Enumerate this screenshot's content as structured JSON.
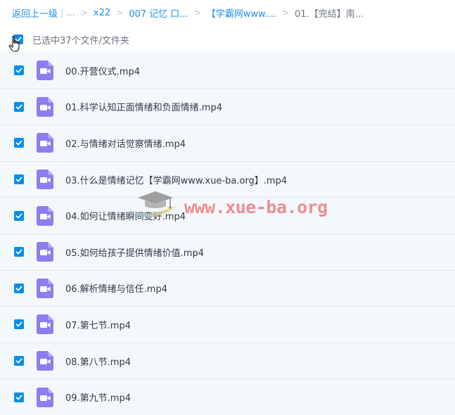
{
  "breadcrumb": {
    "back_label": "返回上一级",
    "pipe": "|",
    "ellipsis": "...",
    "sep": ">",
    "crumbs": [
      "x22",
      "007 记忆 口...",
      "【学霸网www....",
      "01.【完结】南..."
    ]
  },
  "selection": {
    "text": "已选中37个文件/文件夹",
    "all_checked": true
  },
  "files": [
    {
      "name": "00.开营仪式.mp4",
      "checked": true
    },
    {
      "name": "01.科学认知正面情绪和负面情绪.mp4",
      "checked": true
    },
    {
      "name": "02.与情绪对话觉察情绪.mp4",
      "checked": true
    },
    {
      "name": "03.什么是情绪记忆【学霸网www.xue-ba.org】.mp4",
      "checked": true
    },
    {
      "name": "04.如何让情绪瞬间变好.mp4",
      "checked": true
    },
    {
      "name": "05.如何给孩子提供情绪价值.mp4",
      "checked": true
    },
    {
      "name": "06.解析情绪与信任.mp4",
      "checked": true
    },
    {
      "name": "07.第七节.mp4",
      "checked": true
    },
    {
      "name": "08.第八节.mp4",
      "checked": true
    },
    {
      "name": "09.第九节.mp4",
      "checked": true
    }
  ],
  "watermark": {
    "text": "www.xue-ba.org",
    "icon": "graduation-cap-icon"
  },
  "icons": {
    "file": "video-file-icon",
    "checkbox": "checkmark-icon",
    "cursor": "hand-cursor-icon"
  },
  "colors": {
    "accent": "#1e90e6",
    "checkbox": "#0a8ee8",
    "file_icon": "#8d7df0",
    "row_bg": "#f3f8fd",
    "watermark": "#e96767"
  }
}
